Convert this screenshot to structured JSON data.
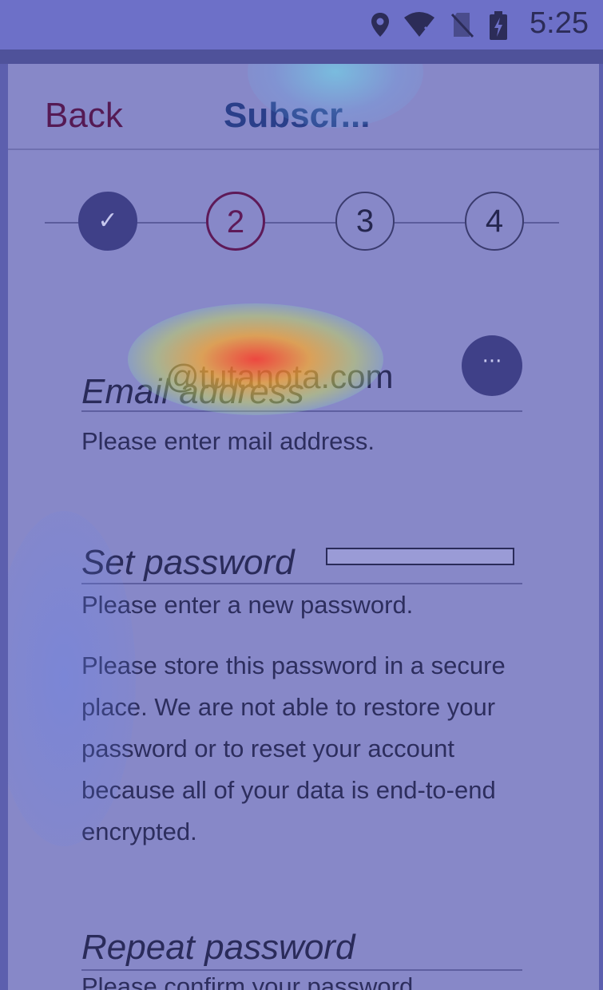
{
  "status_bar": {
    "time": "5:25",
    "icons": [
      "location-icon",
      "wifi-off-icon",
      "no-sim-icon",
      "battery-charging-icon"
    ]
  },
  "header": {
    "back_label": "Back",
    "title": "Subscr..."
  },
  "stepper": {
    "steps": [
      {
        "label": "✓",
        "state": "done"
      },
      {
        "label": "2",
        "state": "active"
      },
      {
        "label": "3",
        "state": "pending"
      },
      {
        "label": "4",
        "state": "pending"
      }
    ]
  },
  "email": {
    "label": "Email address",
    "domain_suffix": "@tutanota.com",
    "more_label": "···",
    "helper": "Please enter mail address."
  },
  "password": {
    "label": "Set password",
    "helper": "Please enter a new password.",
    "info": "Please store this password in a secure place. We are not able to restore your password or to reset your account because all of your data is end-to-end encrypted."
  },
  "repeat_password": {
    "label": "Repeat password",
    "helper": "Please confirm your password."
  },
  "colors": {
    "overlay": "#8788c8",
    "accent": "#5e1a58",
    "title": "#2a3f8a"
  }
}
